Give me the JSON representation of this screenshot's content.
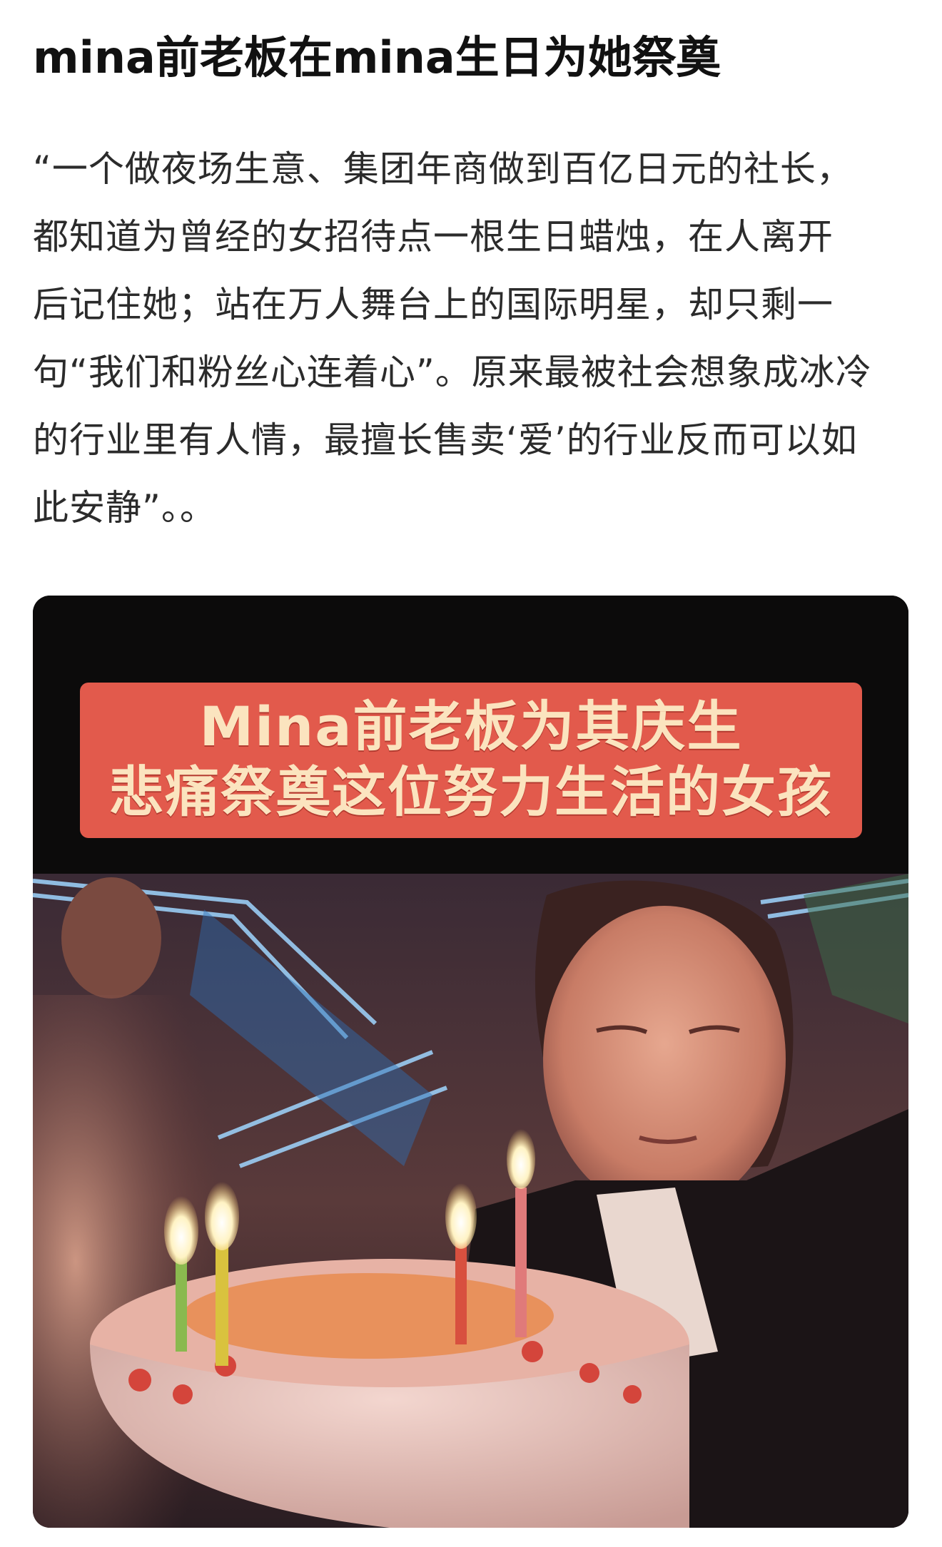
{
  "post": {
    "title": "mina前老板在mina生日为她祭奠",
    "body_lines": [
      "“一个做夜场生意、集团年商做到百亿日元的社长，",
      "都知道为曾经的女招待点一根生日蜡烛，在人离开",
      "后记住她；站在万人舞台上的国际明星，却只剩一",
      "句“我们和粉丝心连着心”。原来最被社会想象成冰冷",
      "的行业里有人情，最擅长售卖‘爱’的行业反而可以如",
      "此安静”。。"
    ]
  },
  "video_frame": {
    "caption_line_1": "Mina前老板为其庆生",
    "caption_line_2": "悲痛祭奠这位努力生活的女孩",
    "caption_bg_color": "#e25a4c",
    "caption_text_color": "#fbe4bf"
  }
}
